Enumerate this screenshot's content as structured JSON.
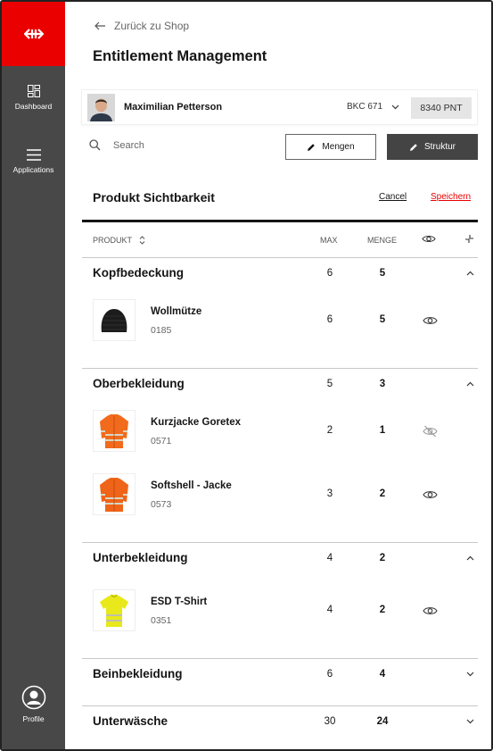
{
  "sidebar": {
    "logo_icon": "sbb-logo-icon",
    "items": [
      {
        "label": "Dashboard",
        "icon": "dashboard-icon"
      },
      {
        "label": "Applications",
        "icon": "menu-icon"
      }
    ],
    "profile": {
      "label": "Profile",
      "icon": "profile-icon"
    }
  },
  "header": {
    "back_label": "Zurück zu Shop",
    "title": "Entitlement Management"
  },
  "user": {
    "name": "Maximilian Petterson",
    "account": "BKC 671",
    "points": "8340 PNT"
  },
  "toolbar": {
    "search_placeholder": "Search",
    "mengen_label": "Mengen",
    "struktur_label": "Struktur"
  },
  "section": {
    "title": "Produkt Sichtbarkeit",
    "cancel_label": "Cancel",
    "save_label": "Speichern"
  },
  "table": {
    "columns": {
      "produkt": "PRODUKT",
      "max": "MAX",
      "menge": "MENGE"
    },
    "categories": [
      {
        "name": "Kopfbedeckung",
        "max": "6",
        "menge": "5",
        "expanded": true,
        "products": [
          {
            "name": "Wollmütze",
            "code": "0185",
            "max": "6",
            "menge": "5",
            "visible": true
          }
        ]
      },
      {
        "name": "Oberbekleidung",
        "max": "5",
        "menge": "3",
        "expanded": true,
        "products": [
          {
            "name": "Kurzjacke Goretex",
            "code": "0571",
            "max": "2",
            "menge": "1",
            "visible": false
          },
          {
            "name": "Softshell - Jacke",
            "code": "0573",
            "max": "3",
            "menge": "2",
            "visible": true
          }
        ]
      },
      {
        "name": "Unterbekleidung",
        "max": "4",
        "menge": "2",
        "expanded": true,
        "products": [
          {
            "name": "ESD T-Shirt",
            "code": "0351",
            "max": "4",
            "menge": "2",
            "visible": true
          }
        ]
      },
      {
        "name": "Beinbekleidung",
        "max": "6",
        "menge": "4",
        "expanded": false,
        "products": []
      },
      {
        "name": "Unterwäsche",
        "max": "30",
        "menge": "24",
        "expanded": false,
        "products": []
      }
    ]
  },
  "colors": {
    "brand_red": "#eb0000",
    "sidebar": "#484848",
    "dark_button": "#444444"
  }
}
